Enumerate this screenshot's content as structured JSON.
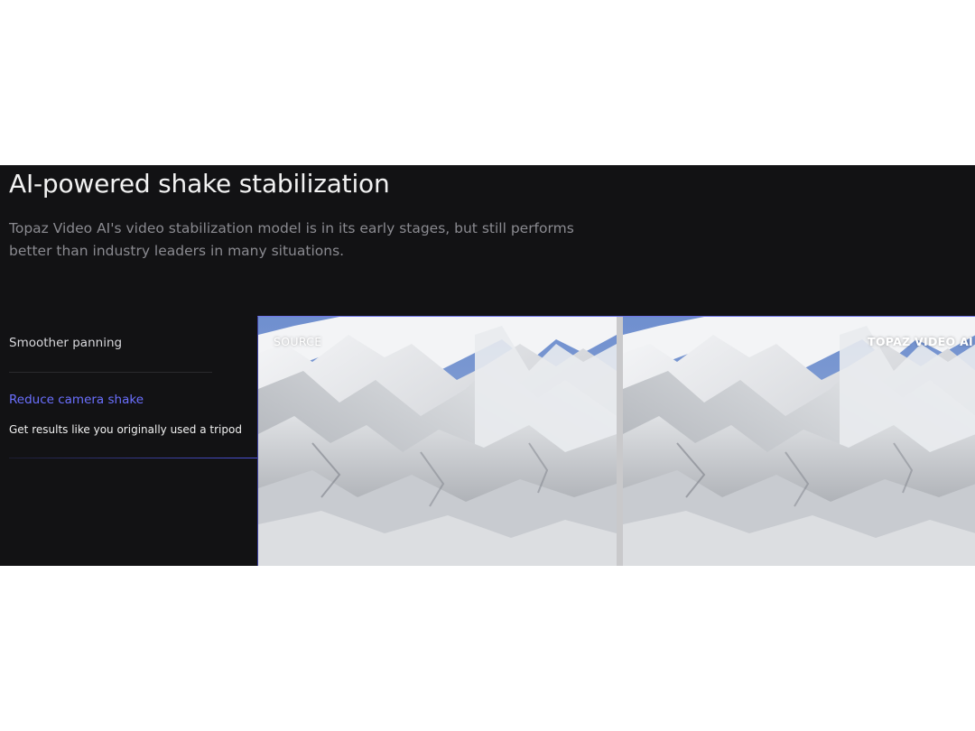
{
  "section": {
    "title": "AI-powered shake stabilization",
    "description": "Topaz Video AI's video stabilization model is in its early stages, but still performs better than industry leaders in many situations."
  },
  "features": [
    {
      "label": "Smoother panning",
      "active": false
    },
    {
      "label": "Reduce camera shake",
      "active": true,
      "description": "Get results like you originally used a tripod"
    }
  ],
  "comparison": {
    "left_label": "SOURCE",
    "right_label": "TOPAZ VIDEO AI",
    "subject": "glacier ice peaks under blue sky"
  },
  "colors": {
    "background": "#121214",
    "accent": "#6b70ff",
    "sky": "#7a96c8",
    "ice": "#e4e6e9"
  }
}
